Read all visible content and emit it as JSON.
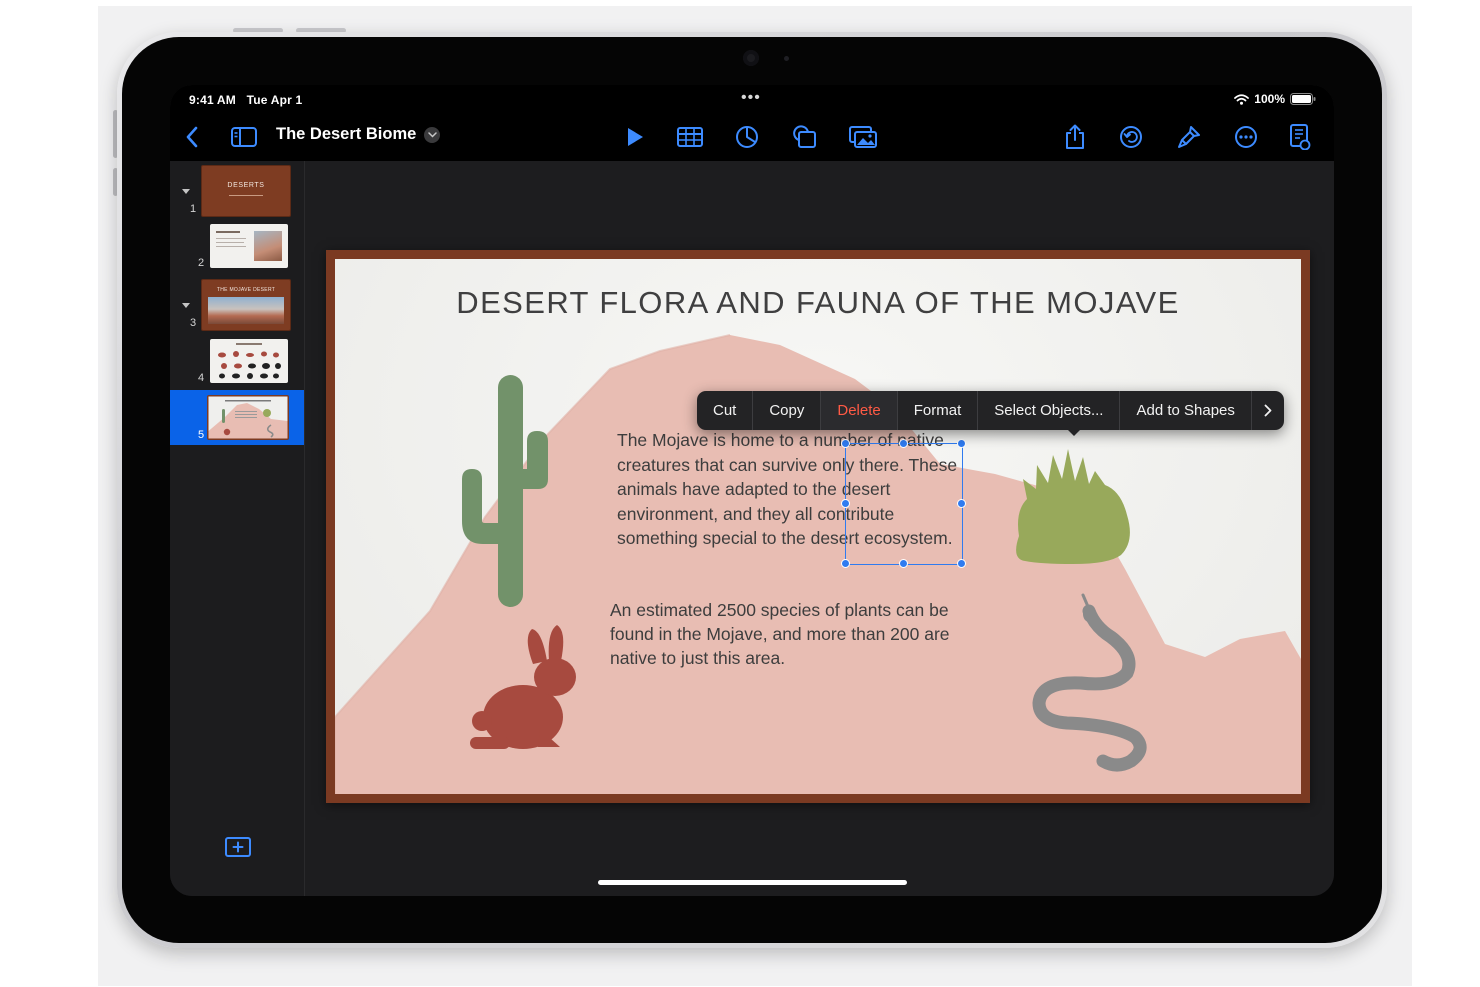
{
  "status_bar": {
    "time": "9:41 AM",
    "date": "Tue Apr 1",
    "battery": "100%",
    "center_indicator": "•••"
  },
  "toolbar": {
    "doc_title": "The Desert Biome",
    "left_icons": [
      "back-chevron-icon",
      "sidebar-icon",
      "title-chevron-icon"
    ],
    "center_icons": [
      "play-icon",
      "table-icon",
      "chart-icon",
      "shape-icon",
      "media-icon"
    ],
    "right_icons": [
      "share-icon",
      "undo-icon",
      "format-brush-icon",
      "more-icon",
      "presenter-notes-icon"
    ],
    "accent_color": "#3d8bff"
  },
  "navigator": {
    "slides": [
      {
        "number": "1",
        "label": "DESERTS",
        "group": true
      },
      {
        "number": "2",
        "group": false
      },
      {
        "number": "3",
        "label": "THE MOJAVE DESERT",
        "group": true
      },
      {
        "number": "4",
        "group": false
      },
      {
        "number": "5",
        "group": false,
        "selected": true
      }
    ],
    "add_slide_icon": "add-slide-icon",
    "selected_color": "#0a63e8"
  },
  "slide": {
    "title": "DESERT FLORA AND FAUNA OF THE MOJAVE",
    "paragraph_1": "The Mojave is home to a number of native creatures that can survive only there. These animals have adapted to the desert environment, and they all contribute something special to the desert ecosystem.",
    "paragraph_2": "An estimated 2500 species of plants can be found in the Mojave, and more than 200 are native to just this area.",
    "objects": [
      "cactus",
      "rabbit",
      "agave",
      "snake",
      "mountain"
    ],
    "colors": {
      "frame": "#7b3a22",
      "mountain": "#e8bdb3",
      "cactus": "#72926a",
      "rabbit": "#a74a3f",
      "agave": "#98a95b",
      "snake": "#8a8a8a"
    }
  },
  "context_menu": {
    "items": [
      "Cut",
      "Copy",
      "Delete",
      "Format",
      "Select Objects...",
      "Add to Shapes"
    ],
    "more_icon": "chevron-right-icon",
    "danger_color": "#ff5a45"
  }
}
